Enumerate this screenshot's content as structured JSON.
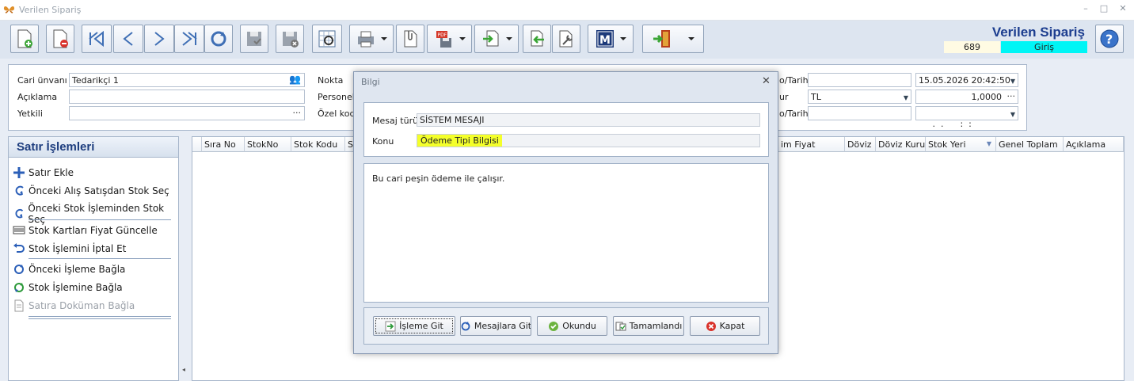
{
  "window": {
    "title": "Verilen Sipariş",
    "minimize": "–",
    "maximize": "□",
    "close": "✕"
  },
  "document": {
    "title": "Verilen Sipariş",
    "number": "689",
    "state": "Giriş"
  },
  "header_form": {
    "cari_label": "Cari ünvanı",
    "cari_value": "Tedarikçi 1",
    "aciklama_label": "Açıklama",
    "aciklama_value": "",
    "yetkili_label": "Yetkili",
    "yetkili_value": "",
    "yetkili_ellipsis": "···",
    "nokta_label": "Nokta",
    "personel_label": "Personel",
    "ozelkod_label": "Özel kod",
    "tarih1_label": "o/Tarih",
    "tarih1_value": "",
    "tarih1_datetime": "15.05.2026 20:42:50",
    "kur_label": "ur",
    "kur_currency": "TL",
    "kur_value": "1,0000",
    "kur_ellipsis": "···",
    "tarih2_label": "o/Tarih",
    "tarih2_value": "",
    "tarih2_datetime": " .  .      :  :"
  },
  "left_panel": {
    "title": "Satır İşlemleri",
    "items": [
      {
        "label": "Satır Ekle",
        "icon": "plus-icon"
      },
      {
        "label": "Önceki Alış Satışdan Stok Seç",
        "icon": "back-arrow-icon"
      },
      {
        "label": "Önceki Stok İşleminden Stok Seç",
        "icon": "back-arrow-icon"
      },
      {
        "label": "Stok Kartları Fiyat Güncelle",
        "icon": "barcode-icon"
      },
      {
        "label": "Stok İşlemini İptal Et",
        "icon": "undo-icon"
      },
      {
        "label": "Önceki İşleme Bağla",
        "icon": "sync-icon"
      },
      {
        "label": "Stok İşlemine Bağla",
        "icon": "link-icon"
      },
      {
        "label": "Satıra Doküman Bağla",
        "icon": "document-icon"
      }
    ]
  },
  "grid": {
    "columns": [
      "Sıra No",
      "StokNo",
      "Stok Kodu",
      "S",
      "im Fiyat",
      "Döviz",
      "Döviz Kuru",
      "Stok Yeri",
      "Genel Toplam",
      "Açıklama"
    ]
  },
  "dialog": {
    "title": "Bilgi",
    "close": "✕",
    "mesaj_turu_label": "Mesaj türü",
    "mesaj_turu_value": "SİSTEM MESAJI",
    "konu_label": "Konu",
    "konu_value": "Ödeme Tipi Bilgisi",
    "body": "Bu cari peşin ödeme ile çalışır.",
    "buttons": {
      "islem": "İşleme Git",
      "mesajlar": "Mesajlara Git",
      "okundu": "Okundu",
      "tamamlandi": "Tamamlandı",
      "kapat": "Kapat"
    }
  },
  "colors": {
    "accent": "#1c3d8f",
    "state_bg": "#00f5f5",
    "highlight": "#f4ff2a"
  }
}
